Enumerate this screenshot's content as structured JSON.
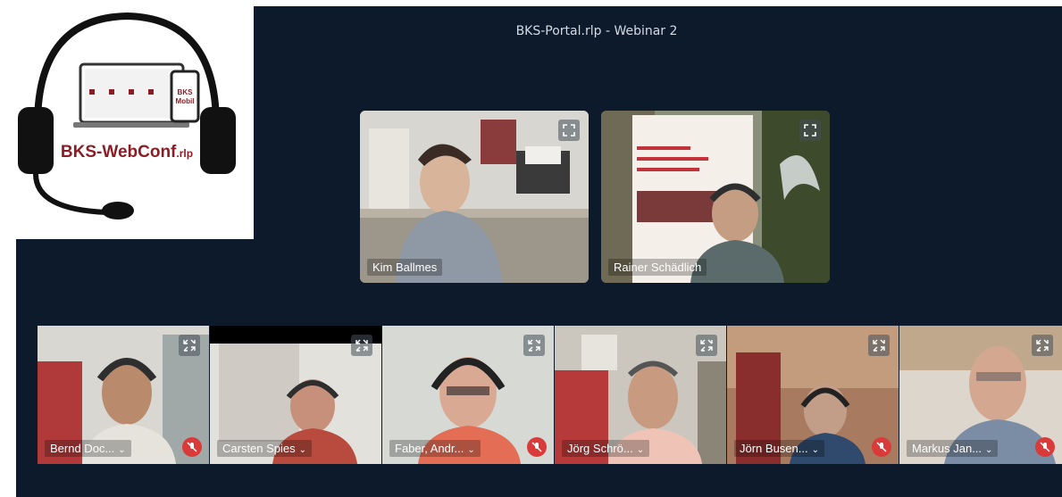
{
  "app": {
    "title": "BKS-Portal.rlp - Webinar 2",
    "logo_text_main": "BKS-WebConf",
    "logo_text_suffix": ".rlp",
    "logo_device_text": "BKS Mobil"
  },
  "spotlight": [
    {
      "name": "Kim Ballmes"
    },
    {
      "name": "Rainer Schädlich"
    }
  ],
  "participants": [
    {
      "name": "Bernd Doc...",
      "muted": true
    },
    {
      "name": "Carsten Spies",
      "muted": false
    },
    {
      "name": "Faber, Andr...",
      "muted": true
    },
    {
      "name": "Jörg Schrö...",
      "muted": false
    },
    {
      "name": "Jörn Busen...",
      "muted": true
    },
    {
      "name": "Markus Jan...",
      "muted": true
    }
  ],
  "colors": {
    "stage_bg": "#0d1a2b",
    "mute_red": "#d93a3a",
    "logo_red": "#8c1d26"
  }
}
